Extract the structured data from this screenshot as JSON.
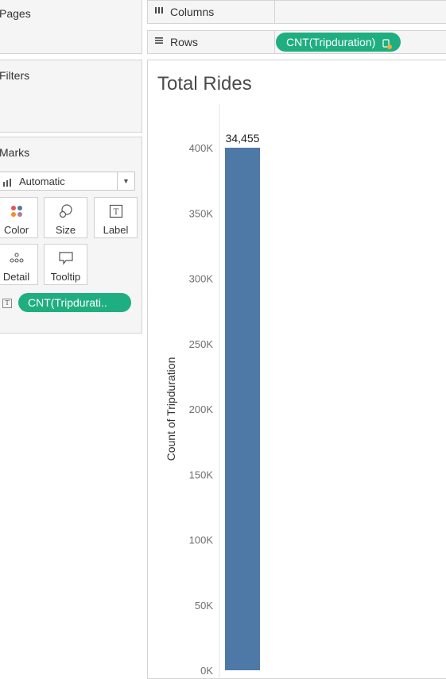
{
  "cards": {
    "pages": {
      "title": "Pages"
    },
    "filters": {
      "title": "Filters"
    },
    "marks": {
      "title": "Marks",
      "mark_type": "Automatic",
      "buttons": {
        "color": "Color",
        "size": "Size",
        "label": "Label",
        "detail": "Detail",
        "tooltip": "Tooltip"
      },
      "label_pill": "CNT(Tripdurati.."
    }
  },
  "shelves": {
    "columns": {
      "label": "Columns",
      "icon": "columns-icon"
    },
    "rows": {
      "label": "Rows",
      "icon": "rows-icon",
      "pill": "CNT(Tripduration)"
    }
  },
  "view": {
    "title": "Total Rides"
  },
  "colors": {
    "pill": "#1fae7f",
    "bar": "#4e79a7",
    "panel": "#f5f5f5"
  },
  "chart_data": {
    "type": "bar",
    "title": "Total Rides",
    "ylabel": "Count of Tripduration",
    "xlabel": "",
    "categories": [
      ""
    ],
    "values": [
      400000
    ],
    "data_labels": [
      "34,455"
    ],
    "ylim": [
      0,
      400000
    ],
    "yticks": [
      0,
      50000,
      100000,
      150000,
      200000,
      250000,
      300000,
      350000,
      400000
    ],
    "ytick_labels": [
      "0K",
      "50K",
      "100K",
      "150K",
      "200K",
      "250K",
      "300K",
      "350K",
      "400K"
    ],
    "grid": false,
    "color": "#4e79a7"
  }
}
